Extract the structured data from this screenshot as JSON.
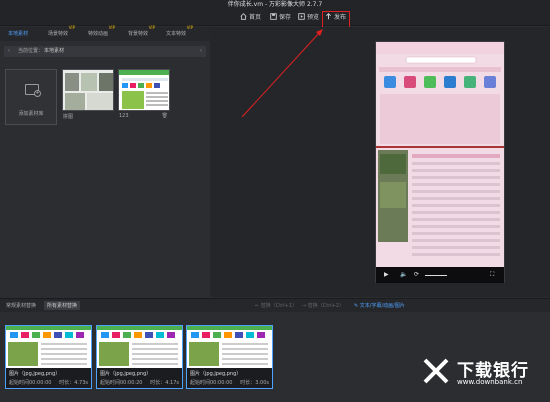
{
  "window": {
    "title": "伴你成长.vm - 万彩影像大师 2.7.7"
  },
  "toolbar": {
    "home": "首页",
    "save": "保存",
    "preview": "预览",
    "publish": "发布"
  },
  "material_tabs": [
    {
      "label": "本地素材",
      "vip": ""
    },
    {
      "label": "场景特效",
      "vip": "VIP"
    },
    {
      "label": "特效动画",
      "vip": "VIP"
    },
    {
      "label": "背景特效",
      "vip": "VIP"
    },
    {
      "label": "文本特效",
      "vip": "VIP"
    }
  ],
  "path": {
    "label": "当前位置：",
    "value": "本地素材"
  },
  "add_material": {
    "label": "添加素材库"
  },
  "materials": [
    {
      "name": "拼图"
    },
    {
      "name": "123"
    }
  ],
  "bottom_tabs": {
    "regular": "常规素材替换",
    "all": "所有素材替换"
  },
  "bottom_controls": {
    "replace_prev": "← 替换（Ctrl+1）",
    "replace_next": "→ 替换（Ctrl+2）",
    "text_captions": "文本/字幕/动画/图片"
  },
  "clips": [
    {
      "title": "图片（jpg,jpeg,png）",
      "start": "起始时间00:00:00",
      "duration": "时长：4.73s"
    },
    {
      "title": "图片（jpg,jpeg,png）",
      "start": "起始时间00:00:20",
      "duration": "时长：4.17s"
    },
    {
      "title": "图片（jpg,jpeg,png）",
      "start": "起始时间00:00:00",
      "duration": "时长：3.00s"
    }
  ],
  "watermark": {
    "name": "下载银行",
    "url": "www.downbank.cn"
  },
  "colors": {
    "accent": "#4ea3ff",
    "highlight": "#e02020",
    "vip": "#e8b60c",
    "background": "#2b2d31"
  },
  "icons": [
    "home-icon",
    "save-icon",
    "preview-icon",
    "publish-icon",
    "folder-add-icon",
    "play-icon",
    "volume-icon",
    "fullscreen-icon",
    "delete-icon",
    "back-icon"
  ]
}
